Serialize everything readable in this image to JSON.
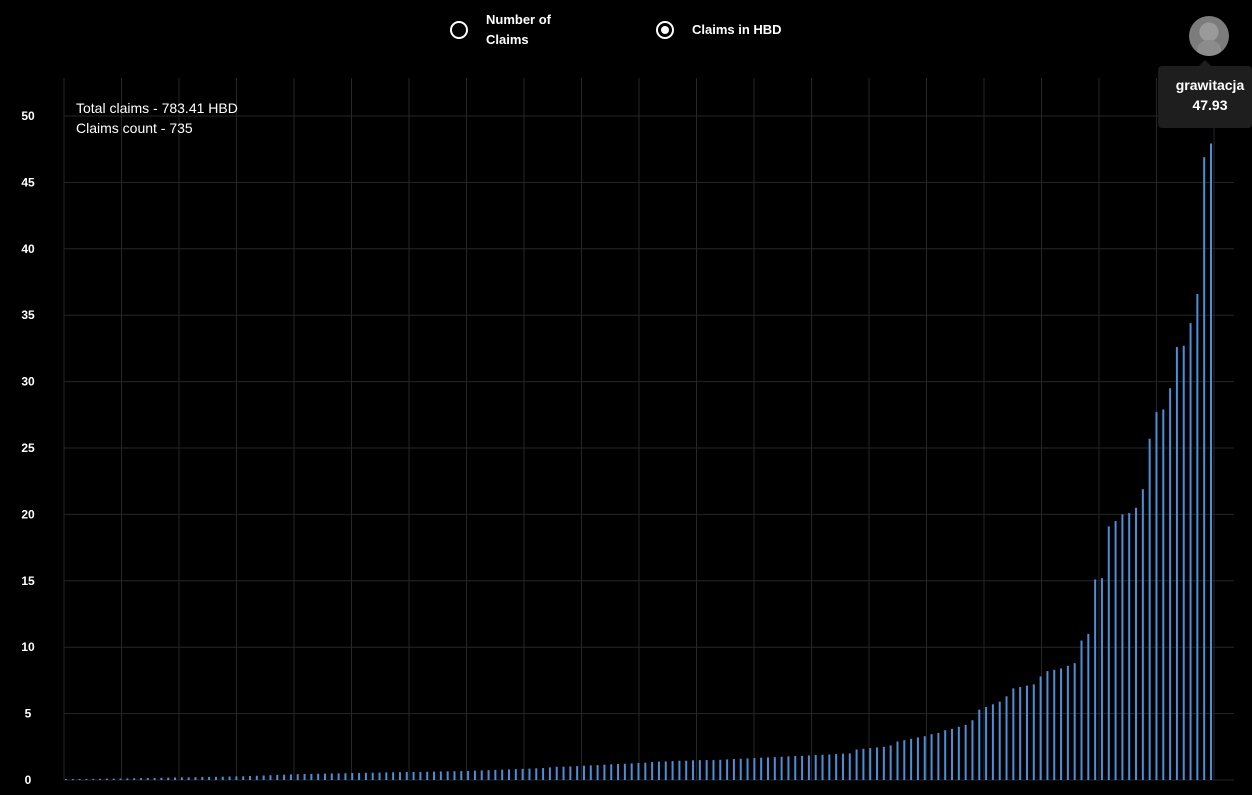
{
  "controls": {
    "option_count_label": "Number of\nClaims",
    "option_hbd_label": "Claims in HBD",
    "selected": "hbd"
  },
  "summary": {
    "total_claims": "Total claims - 783.41 HBD",
    "claims_count": "Claims count - 735"
  },
  "tooltip": {
    "name": "grawitacja",
    "value": "47.93"
  },
  "colors": {
    "bar": "#4a90d9",
    "grid": "#262626",
    "background": "#000000"
  },
  "chart_data": {
    "type": "bar",
    "title": "",
    "xlabel": "",
    "ylabel": "",
    "ylim": [
      0,
      50
    ],
    "yticks": [
      0,
      5,
      10,
      15,
      20,
      25,
      30,
      35,
      40,
      45,
      50
    ],
    "grid": true,
    "series": [
      {
        "values": [
          0.05,
          0.05,
          0.06,
          0.07,
          0.08,
          0.09,
          0.1,
          0.1,
          0.11,
          0.12,
          0.13,
          0.14,
          0.15,
          0.16,
          0.17,
          0.18,
          0.19,
          0.2,
          0.2,
          0.21,
          0.22,
          0.23,
          0.24,
          0.25,
          0.26,
          0.27,
          0.28,
          0.3,
          0.32,
          0.34,
          0.36,
          0.38,
          0.4,
          0.42,
          0.44,
          0.45,
          0.46,
          0.47,
          0.48,
          0.49,
          0.5,
          0.51,
          0.52,
          0.53,
          0.54,
          0.55,
          0.56,
          0.57,
          0.58,
          0.59,
          0.6,
          0.6,
          0.61,
          0.62,
          0.63,
          0.64,
          0.65,
          0.66,
          0.67,
          0.68,
          0.7,
          0.72,
          0.74,
          0.76,
          0.78,
          0.8,
          0.82,
          0.84,
          0.86,
          0.88,
          0.9,
          0.95,
          1.0,
          1.0,
          1.02,
          1.05,
          1.08,
          1.1,
          1.12,
          1.15,
          1.18,
          1.2,
          1.22,
          1.25,
          1.28,
          1.3,
          1.35,
          1.38,
          1.4,
          1.42,
          1.45,
          1.45,
          1.48,
          1.5,
          1.5,
          1.5,
          1.52,
          1.55,
          1.58,
          1.6,
          1.62,
          1.65,
          1.68,
          1.7,
          1.72,
          1.75,
          1.78,
          1.8,
          1.82,
          1.85,
          1.88,
          1.9,
          1.92,
          1.95,
          1.98,
          2.0,
          2.3,
          2.35,
          2.4,
          2.45,
          2.5,
          2.6,
          2.9,
          3.0,
          3.1,
          3.2,
          3.3,
          3.45,
          3.55,
          3.75,
          3.85,
          4.0,
          4.15,
          4.5,
          5.3,
          5.5,
          5.7,
          5.9,
          6.3,
          6.9,
          7.0,
          7.1,
          7.2,
          7.8,
          8.2,
          8.3,
          8.4,
          8.6,
          8.8,
          10.5,
          11.0,
          15.1,
          15.2,
          19.1,
          19.5,
          20.0,
          20.1,
          20.5,
          21.9,
          25.7,
          27.7,
          27.9,
          29.5,
          32.6,
          32.7,
          34.4,
          36.6,
          46.9,
          47.93
        ]
      }
    ]
  }
}
